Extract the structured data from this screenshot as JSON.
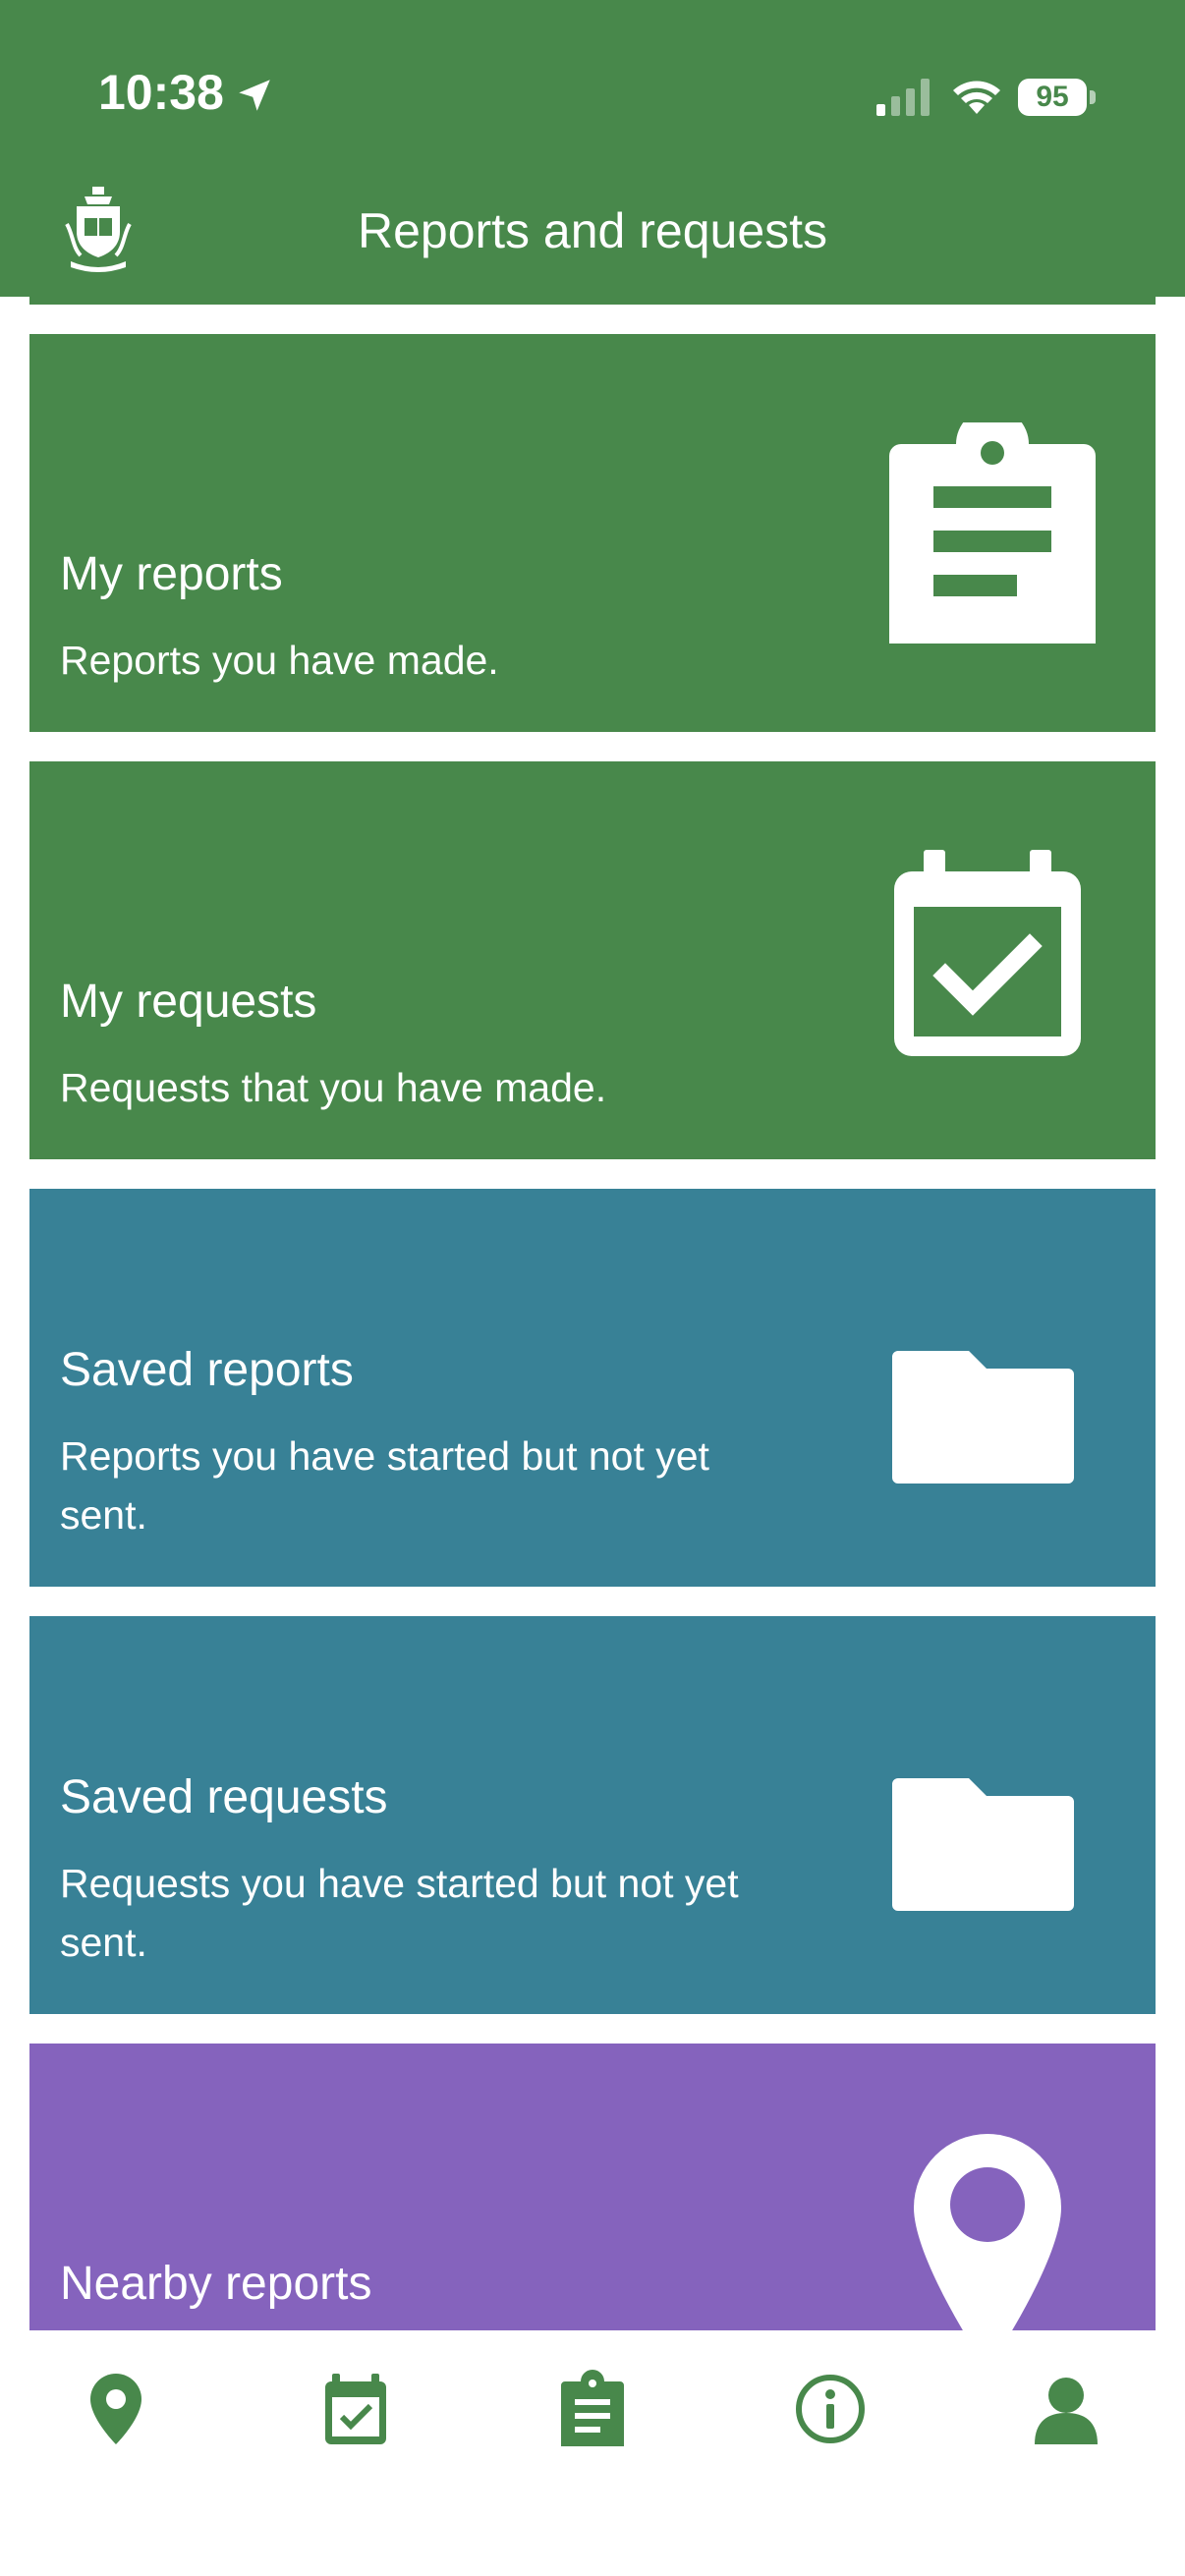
{
  "status_bar": {
    "time": "10:38",
    "battery": "95"
  },
  "header": {
    "title": "Reports and requests"
  },
  "cards": [
    {
      "title": "My reports",
      "description": "Reports you have made.",
      "color": "#48884b",
      "icon": "clipboard-icon"
    },
    {
      "title": "My requests",
      "description": "Requests that you have made.",
      "color": "#48884b",
      "icon": "calendar-check-icon"
    },
    {
      "title": "Saved reports",
      "description": "Reports you have started but not yet sent.",
      "color": "#388196",
      "icon": "folder-icon"
    },
    {
      "title": "Saved requests",
      "description": "Requests you have started but not yet sent.",
      "color": "#388196",
      "icon": "folder-icon"
    },
    {
      "title": "Nearby reports",
      "color": "#8563bd",
      "icon": "location-pin-icon"
    }
  ],
  "bottom_nav": [
    {
      "icon": "map-pin-icon"
    },
    {
      "icon": "calendar-check-icon"
    },
    {
      "icon": "clipboard-icon"
    },
    {
      "icon": "info-icon"
    },
    {
      "icon": "user-icon"
    }
  ],
  "colors": {
    "brand_green": "#48884b",
    "teal": "#388196",
    "purple": "#8563bd",
    "white": "#ffffff"
  }
}
